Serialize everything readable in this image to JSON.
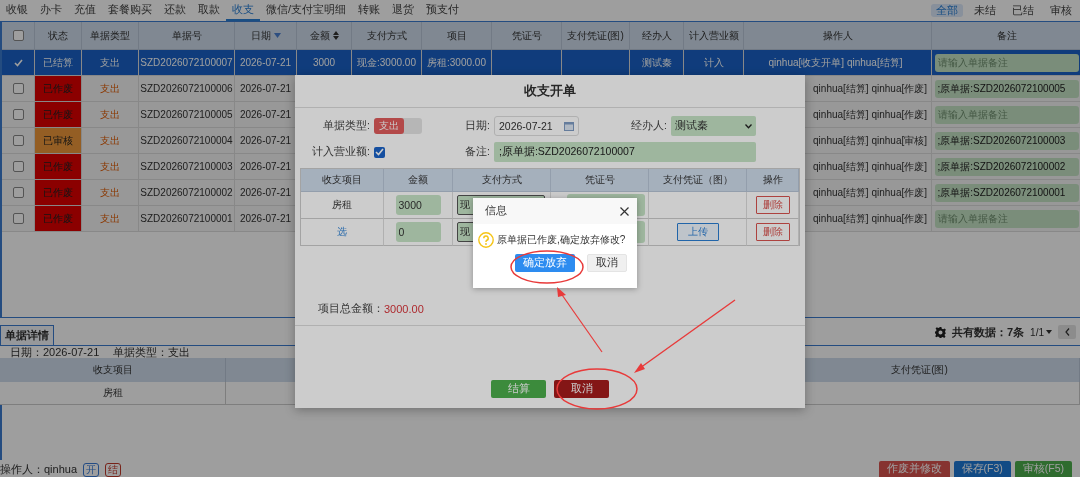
{
  "nav": {
    "tabs": [
      {
        "label": "收银",
        "selected": false
      },
      {
        "label": "办卡",
        "selected": false
      },
      {
        "label": "充值",
        "selected": false
      },
      {
        "label": "套餐购买",
        "selected": false
      },
      {
        "label": "还款",
        "selected": false
      },
      {
        "label": "取款",
        "selected": false
      },
      {
        "label": "收支",
        "selected": true
      },
      {
        "label": "微信/支付宝明细",
        "selected": false
      },
      {
        "label": "转账",
        "selected": false
      },
      {
        "label": "退货",
        "selected": false
      },
      {
        "label": "预支付",
        "selected": false
      }
    ],
    "filters": [
      {
        "label": "全部",
        "selected": true
      },
      {
        "label": "未结",
        "selected": false
      },
      {
        "label": "已结",
        "selected": false
      },
      {
        "label": "审核",
        "selected": false
      }
    ]
  },
  "table": {
    "select_all": {
      "checked": false
    },
    "columns": [
      {
        "label": "状态"
      },
      {
        "label": "单据类型"
      },
      {
        "label": "单据号"
      },
      {
        "label": "日期",
        "sortable": true,
        "sorted": true
      },
      {
        "label": "金额",
        "sortable": true,
        "sorted": false
      },
      {
        "label": "支付方式"
      },
      {
        "label": "项目"
      },
      {
        "label": "凭证号"
      },
      {
        "label": "支付凭证(图)"
      },
      {
        "label": "经办人"
      },
      {
        "label": "计入营业额"
      },
      {
        "label": "操作人"
      },
      {
        "label": "备注"
      }
    ],
    "rows": [
      {
        "selected": true,
        "checked": true,
        "kind": "settled",
        "status": "已结算",
        "type": "支出",
        "number": "SZD2026072100007",
        "date": "2026-07-21",
        "amount": "3000",
        "payment": "现金:3000.00",
        "item": "房租:3000.00",
        "handler": "测试秦",
        "revenue": "计入",
        "operator": "qinhua[收支开单] qinhua[结算]",
        "remark": {
          "placeholder": "请输入单据备注"
        }
      },
      {
        "selected": false,
        "checked": false,
        "kind": "voided",
        "status": "已作废",
        "type": "支出",
        "number": "SZD2026072100006",
        "date": "2026-07-21",
        "operator": "qinhua[结算] qinhua[作废]",
        "remark": {
          "value": ";原单据:SZD2026072100005"
        }
      },
      {
        "selected": false,
        "checked": false,
        "kind": "voided",
        "status": "已作废",
        "type": "支出",
        "number": "SZD2026072100005",
        "date": "2026-07-21",
        "operator": "qinhua[结算] qinhua[作废]",
        "remark": {
          "placeholder": "请输入单据备注"
        }
      },
      {
        "selected": false,
        "checked": false,
        "kind": "approved",
        "status": "已审核",
        "type": "支出",
        "number": "SZD2026072100004",
        "date": "2026-07-21",
        "operator": "qinhua[结算] qinhua[审核]",
        "remark": {
          "value": ";原单据:SZD2026072100003"
        }
      },
      {
        "selected": false,
        "checked": false,
        "kind": "voided",
        "status": "已作废",
        "type": "支出",
        "number": "SZD2026072100003",
        "date": "2026-07-21",
        "operator": "qinhua[结算] qinhua[作废]",
        "remark": {
          "value": ";原单据:SZD2026072100002"
        }
      },
      {
        "selected": false,
        "checked": false,
        "kind": "voided",
        "status": "已作废",
        "type": "支出",
        "number": "SZD2026072100002",
        "date": "2026-07-21",
        "operator": "qinhua[结算] qinhua[作废]",
        "remark": {
          "value": ";原单据:SZD2026072100001"
        }
      },
      {
        "selected": false,
        "checked": false,
        "kind": "voided",
        "status": "已作废",
        "type": "支出",
        "number": "SZD2026072100001",
        "date": "2026-07-21",
        "operator": "qinhua[结算] qinhua[作废]",
        "remark": {
          "placeholder": "请输入单据备注"
        }
      }
    ]
  },
  "pager": {
    "count": "共有数据：7条",
    "page": "1/1"
  },
  "detail": {
    "tab": "单据详情",
    "date": "日期：2026-07-21",
    "type": "单据类型：支出",
    "columns": [
      "收支项目",
      "支付凭证(图)"
    ],
    "rows": [
      [
        "房租"
      ]
    ]
  },
  "footer": {
    "operator": "操作人：qinhua",
    "badges": [
      {
        "label": "开",
        "kind": "open"
      },
      {
        "label": "结",
        "kind": "settled"
      }
    ],
    "buttons": [
      {
        "label": "作废并修改",
        "kind": "void"
      },
      {
        "label": "保存(F3)",
        "kind": "save"
      },
      {
        "label": "审核(F5)",
        "kind": "audit"
      }
    ]
  },
  "modal": {
    "title": "收支开单",
    "type_label": "单据类型:",
    "type_switch": {
      "label": "支出",
      "on": true
    },
    "date_label": "日期:",
    "date": "2026-07-21",
    "handler_label": "经办人:",
    "handler": "测试秦",
    "revenue_label": "计入营业额:",
    "revenue_checked": true,
    "remark_label": "备注:",
    "remark": ";原单据:SZD2026072100007",
    "columns": [
      "收支项目",
      "金额",
      "支付方式",
      "凭证号",
      "支付凭证（图）",
      "操作"
    ],
    "rows": [
      {
        "kind": "text",
        "item": "房租",
        "amount": "3000",
        "payment": "现",
        "delete": "删除"
      },
      {
        "kind": "link",
        "item": "选",
        "amount": "0",
        "payment": "现",
        "upload": "上传",
        "delete": "删除"
      }
    ],
    "total_label": "项目总金额：",
    "total": "3000.00",
    "buttons": [
      {
        "label": "结算",
        "kind": "settle"
      },
      {
        "label": "取消",
        "kind": "cancel"
      }
    ]
  },
  "dialog": {
    "title": "信息",
    "message": "原单据已作废,确定放弃修改?",
    "buttons": [
      {
        "label": "确定放弃",
        "kind": "primary"
      },
      {
        "label": "取消",
        "kind": "default"
      }
    ]
  }
}
